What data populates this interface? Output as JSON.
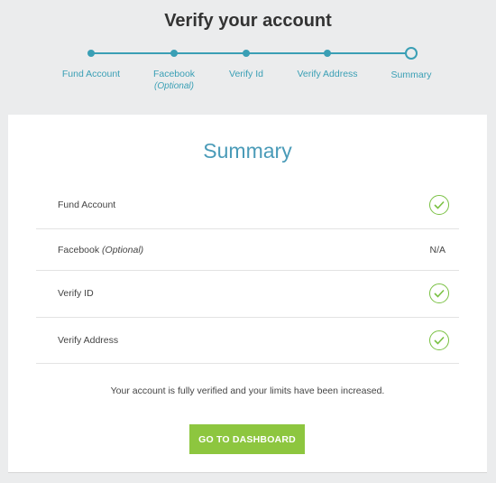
{
  "page": {
    "title": "Verify your account"
  },
  "stepper": {
    "steps": [
      {
        "label": "Fund Account",
        "sub": ""
      },
      {
        "label": "Facebook",
        "sub": "(Optional)"
      },
      {
        "label": "Verify Id",
        "sub": ""
      },
      {
        "label": "Verify Address",
        "sub": ""
      },
      {
        "label": "Summary",
        "sub": ""
      }
    ],
    "current_step": "Summary"
  },
  "summary": {
    "title": "Summary",
    "rows": [
      {
        "label": "Fund Account",
        "status": "check-icon"
      },
      {
        "label": "Facebook",
        "label_italic": "(Optional)",
        "status_text": "N/A"
      },
      {
        "label": "Verify ID",
        "status": "check-icon"
      },
      {
        "label": "Verify Address",
        "status": "check-icon"
      }
    ],
    "message": "Your account is fully verified and your limits have been increased.",
    "button_label": "GO TO DASHBOARD"
  },
  "colors": {
    "accent": "#3a9fb5",
    "success": "#7ac143",
    "button": "#8dc63f",
    "background": "#ebeced"
  }
}
